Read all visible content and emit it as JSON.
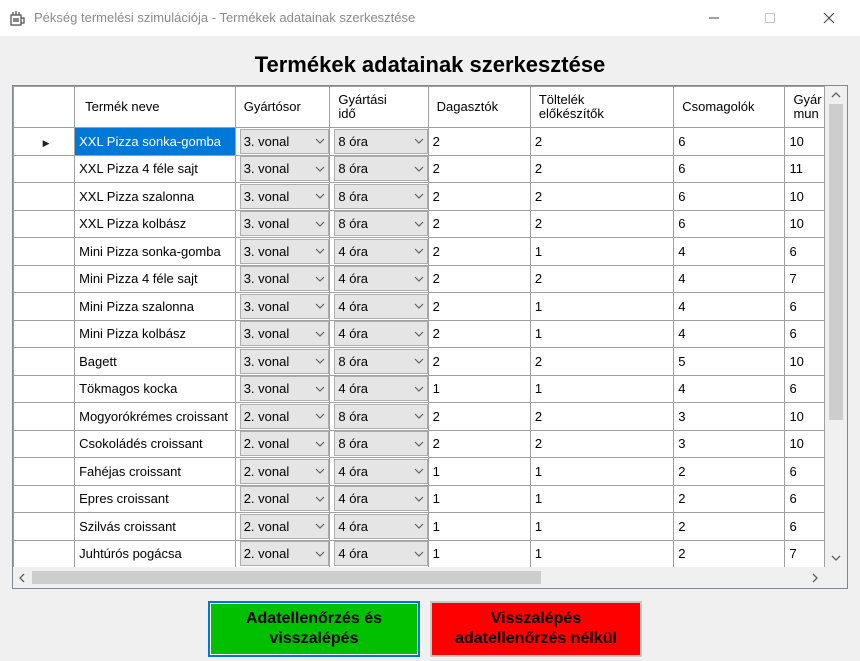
{
  "window": {
    "title": "Pékség termelési szimulációja - Termékek adatainak szerkesztése",
    "app_icon": "bakery-app-icon"
  },
  "heading": "Termékek adatainak szerkesztése",
  "grid": {
    "columns": [
      "",
      "Termék neve",
      "Gyártósor",
      "Gyártási idő",
      "Dagasztók",
      "Töltelék előkészítők",
      "Csomagolók",
      "Gyár mun"
    ],
    "rows": [
      {
        "name": "XXL Pizza sonka-gomba",
        "line": "3. vonal",
        "time": "8 óra",
        "dag": "2",
        "tolt": "2",
        "csom": "6",
        "gyar": "10"
      },
      {
        "name": "XXL Pizza 4 féle sajt",
        "line": "3. vonal",
        "time": "8 óra",
        "dag": "2",
        "tolt": "2",
        "csom": "6",
        "gyar": "11"
      },
      {
        "name": "XXL Pizza szalonna",
        "line": "3. vonal",
        "time": "8 óra",
        "dag": "2",
        "tolt": "2",
        "csom": "6",
        "gyar": "10"
      },
      {
        "name": "XXL Pizza kolbász",
        "line": "3. vonal",
        "time": "8 óra",
        "dag": "2",
        "tolt": "2",
        "csom": "6",
        "gyar": "10"
      },
      {
        "name": "Mini Pizza sonka-gomba",
        "line": "3. vonal",
        "time": "4 óra",
        "dag": "2",
        "tolt": "1",
        "csom": "4",
        "gyar": "6"
      },
      {
        "name": "Mini Pizza 4 féle sajt",
        "line": "3. vonal",
        "time": "4 óra",
        "dag": "2",
        "tolt": "2",
        "csom": "4",
        "gyar": "7"
      },
      {
        "name": "Mini Pizza szalonna",
        "line": "3. vonal",
        "time": "4 óra",
        "dag": "2",
        "tolt": "1",
        "csom": "4",
        "gyar": "6"
      },
      {
        "name": "Mini Pizza kolbász",
        "line": "3. vonal",
        "time": "4 óra",
        "dag": "2",
        "tolt": "1",
        "csom": "4",
        "gyar": "6"
      },
      {
        "name": "Bagett",
        "line": "3. vonal",
        "time": "8 óra",
        "dag": "2",
        "tolt": "2",
        "csom": "5",
        "gyar": "10"
      },
      {
        "name": "Tökmagos kocka",
        "line": "3. vonal",
        "time": "4 óra",
        "dag": "1",
        "tolt": "1",
        "csom": "4",
        "gyar": "6"
      },
      {
        "name": "Mogyorókrémes croissant",
        "line": "2. vonal",
        "time": "8 óra",
        "dag": "2",
        "tolt": "2",
        "csom": "3",
        "gyar": "10"
      },
      {
        "name": "Csokoládés croissant",
        "line": "2. vonal",
        "time": "8 óra",
        "dag": "2",
        "tolt": "2",
        "csom": "3",
        "gyar": "10"
      },
      {
        "name": "Fahéjas croissant",
        "line": "2. vonal",
        "time": "4 óra",
        "dag": "1",
        "tolt": "1",
        "csom": "2",
        "gyar": "6"
      },
      {
        "name": "Epres croissant",
        "line": "2. vonal",
        "time": "4 óra",
        "dag": "1",
        "tolt": "1",
        "csom": "2",
        "gyar": "6"
      },
      {
        "name": "Szilvás croissant",
        "line": "2. vonal",
        "time": "4 óra",
        "dag": "1",
        "tolt": "1",
        "csom": "2",
        "gyar": "6"
      },
      {
        "name": "Juhtúrós pogácsa",
        "line": "2. vonal",
        "time": "4 óra",
        "dag": "1",
        "tolt": "1",
        "csom": "2",
        "gyar": "7"
      }
    ],
    "current_row_marker": "▶"
  },
  "buttons": {
    "validate_back": "Adatellenőrzés és\nvisszalépés",
    "back_no_validate": "Visszalépés\nadatellenőrzés nélkül"
  },
  "colors": {
    "selection": "#0078d7",
    "green_button": "#00c000",
    "red_button": "#ff0000"
  }
}
